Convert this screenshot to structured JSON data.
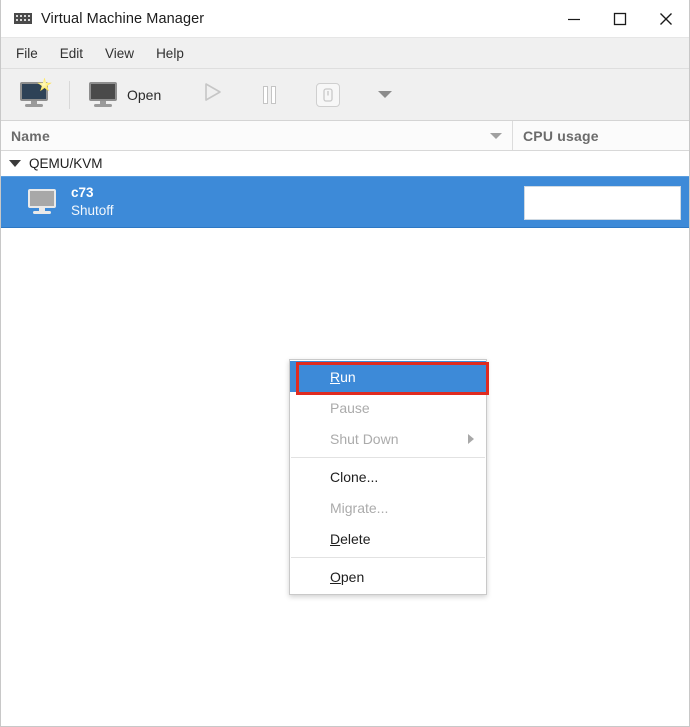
{
  "window": {
    "title": "Virtual Machine Manager",
    "icon": "vmm-app-icon",
    "controls": {
      "minimize": "minimize-icon",
      "maximize": "maximize-icon",
      "close": "close-icon"
    }
  },
  "menubar": {
    "items": [
      {
        "label": "File"
      },
      {
        "label": "Edit"
      },
      {
        "label": "View"
      },
      {
        "label": "Help"
      }
    ]
  },
  "toolbar": {
    "new_vm": {
      "icon": "new-virtual-machine-icon",
      "label": ""
    },
    "open": {
      "icon": "open-monitor-icon",
      "label": "Open",
      "enabled": true
    },
    "run": {
      "icon": "play-icon",
      "label": "",
      "enabled": false
    },
    "pause": {
      "icon": "pause-icon",
      "label": "",
      "enabled": false
    },
    "shutdown": {
      "icon": "shutdown-power-icon",
      "label": "",
      "enabled": false
    },
    "shutdown_menu": {
      "icon": "caret-down-icon",
      "label": "",
      "enabled": false
    }
  },
  "columns": {
    "name": {
      "label": "Name",
      "sort_icon": "caret-down-icon"
    },
    "cpu": {
      "label": "CPU usage"
    }
  },
  "tree": {
    "connection": {
      "label": "QEMU/KVM",
      "expander": "caret-down-icon",
      "expanded": true
    },
    "vms": [
      {
        "name": "c73",
        "state": "Shutoff",
        "icon": "monitor-icon",
        "selected": true,
        "cpu_graph": ""
      }
    ]
  },
  "context_menu": {
    "items": [
      {
        "label": "Run",
        "mnemonic": "R",
        "rest": "un",
        "enabled": true,
        "selected": true,
        "submenu": false
      },
      {
        "label": "Pause",
        "mnemonic": "",
        "rest": "Pause",
        "enabled": false,
        "selected": false,
        "submenu": false
      },
      {
        "label": "Shut Down",
        "mnemonic": "",
        "rest": "Shut Down",
        "enabled": false,
        "selected": false,
        "submenu": true
      },
      {
        "separator": true
      },
      {
        "label": "Clone...",
        "mnemonic": "",
        "rest": "Clone...",
        "enabled": true,
        "selected": false,
        "submenu": false
      },
      {
        "label": "Migrate...",
        "mnemonic": "",
        "rest": "Migrate...",
        "enabled": false,
        "selected": false,
        "submenu": false
      },
      {
        "label": "Delete",
        "mnemonic": "D",
        "rest": "elete",
        "enabled": true,
        "selected": false,
        "submenu": false
      },
      {
        "separator": true
      },
      {
        "label": "Open",
        "mnemonic": "O",
        "rest": "pen",
        "enabled": true,
        "selected": false,
        "submenu": false
      }
    ]
  },
  "annotation": {
    "target": "Run",
    "color": "#e02b20"
  },
  "colors": {
    "selection_blue": "#3d8ad8",
    "toolbar_bg": "#f0f0f0",
    "menubar_bg": "#f0f0f0",
    "header_text": "#6b6b6b",
    "annotation_red": "#e02b20"
  }
}
